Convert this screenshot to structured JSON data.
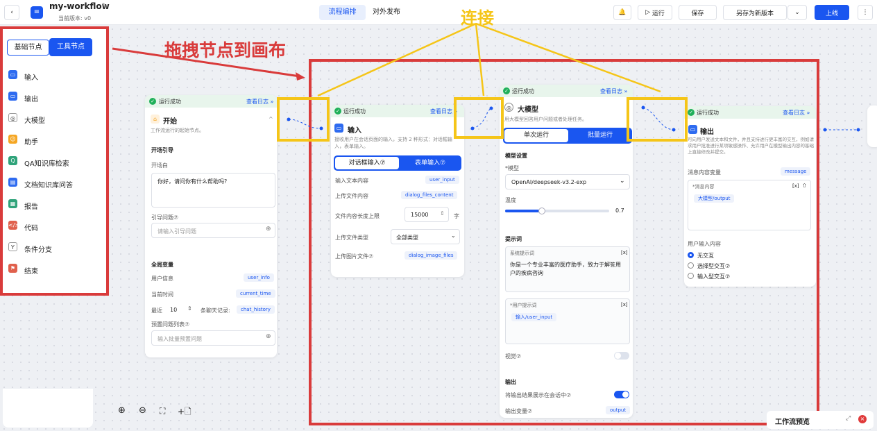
{
  "header": {
    "title": "my-workflow",
    "version": "当前版本: v0",
    "tabs": [
      "流程编排",
      "对外发布"
    ],
    "run": "运行",
    "save": "保存",
    "save_new": "另存为新版本",
    "publish": "上线"
  },
  "sidebar": {
    "tabs": [
      "基础节点",
      "工具节点"
    ],
    "items": [
      {
        "label": "输入",
        "icon": "input-icon",
        "color": "#2e6bf0"
      },
      {
        "label": "输出",
        "icon": "output-icon",
        "color": "#2e6bf0"
      },
      {
        "label": "大模型",
        "icon": "llm-icon",
        "color": "#ffffff"
      },
      {
        "label": "助手",
        "icon": "assistant-icon",
        "color": "#f5a623"
      },
      {
        "label": "QA知识库检索",
        "icon": "qa-icon",
        "color": "#2fa37a"
      },
      {
        "label": "文档知识库问答",
        "icon": "doc-icon",
        "color": "#2e6bf0"
      },
      {
        "label": "报告",
        "icon": "report-icon",
        "color": "#2fa37a"
      },
      {
        "label": "代码",
        "icon": "code-icon",
        "color": "#e0604c"
      },
      {
        "label": "条件分支",
        "icon": "branch-icon",
        "color": "#ffffff"
      },
      {
        "label": "结束",
        "icon": "end-icon",
        "color": "#e0604c"
      }
    ]
  },
  "annotations": {
    "drag": "拖拽节点到画布",
    "connect": "连接"
  },
  "common": {
    "run_success": "运行成功",
    "view_log": "查看日志 »"
  },
  "start": {
    "title": "开始",
    "desc": "工作流运行的起始节点。",
    "guide": "开场引导",
    "opening_label": "开场白",
    "opening": "你好，请问你有什么帮助吗?",
    "guide_q": "引导问题⑦",
    "guide_q_ph": "请输入引导问题",
    "globals": "全局变量",
    "user_info": "用户信息",
    "user_info_var": "user_info",
    "cur_time": "当前时间",
    "cur_time_var": "current_time",
    "recent": "最近",
    "recent_n": "10",
    "chat_rec": "条聊天记录:",
    "chat_var": "chat_history",
    "preset": "预置问题列表⑦",
    "preset_ph": "输入批量预置问题"
  },
  "input": {
    "title": "输入",
    "desc": "接收用户在会话页面的输入，支持 2 种形式：对话框输入，表单输入。",
    "tab1": "对话框输入⑦",
    "tab2": "表单输入⑦",
    "r1": "输入文本内容",
    "r1v": "user_input",
    "r2": "上传文件内容",
    "r2v": "dialog_files_content",
    "r3": "文件内容长度上限",
    "r3v": "15000",
    "r3u": "字",
    "r4": "上传文件类型",
    "r4v": "全部类型",
    "r5": "上传图片文件⑦",
    "r5v": "dialog_image_files"
  },
  "llm": {
    "title": "大模型",
    "desc": "用大模型回答用户问题或者处理任务。",
    "btn1": "单次运行",
    "btn2": "批量运行",
    "model_settings": "模型设置",
    "model_label": "*模型",
    "model": "OpenAI/deepseek-v3.2-exp",
    "temp_label": "温度",
    "temp": "0.7",
    "temp_fraction": 0.35,
    "prompt": "提示词",
    "sys_label": "系统提示词",
    "sys": "你是一个专业丰富的医疗助手，致力于解答用户的疾病咨询",
    "user_label": "*用户提示词",
    "user_tag": "输入/user_input",
    "vision": "视觉⑦",
    "output": "输出",
    "show": "将输出结果展示在会话中⑦",
    "outvar": "输出变量⑦",
    "outvar_v": "output"
  },
  "output": {
    "title": "输出",
    "desc": "可向用户发送文本和文件，并且支持进行更丰富的交互，例如请求用户批准进行某项敏感操作、允许用户在模型输出内容的基础上直接修改并提交。",
    "msgvar": "消息内容变量",
    "msgvar_v": "message",
    "msg_label": "*消息内容",
    "msg_tag": "大模型/output",
    "ui_label": "用户输入内容",
    "opt1": "无交互",
    "opt2": "选择型交互⑦",
    "opt3": "输入型交互⑦"
  },
  "footer": {
    "preview": "工作流预览"
  }
}
